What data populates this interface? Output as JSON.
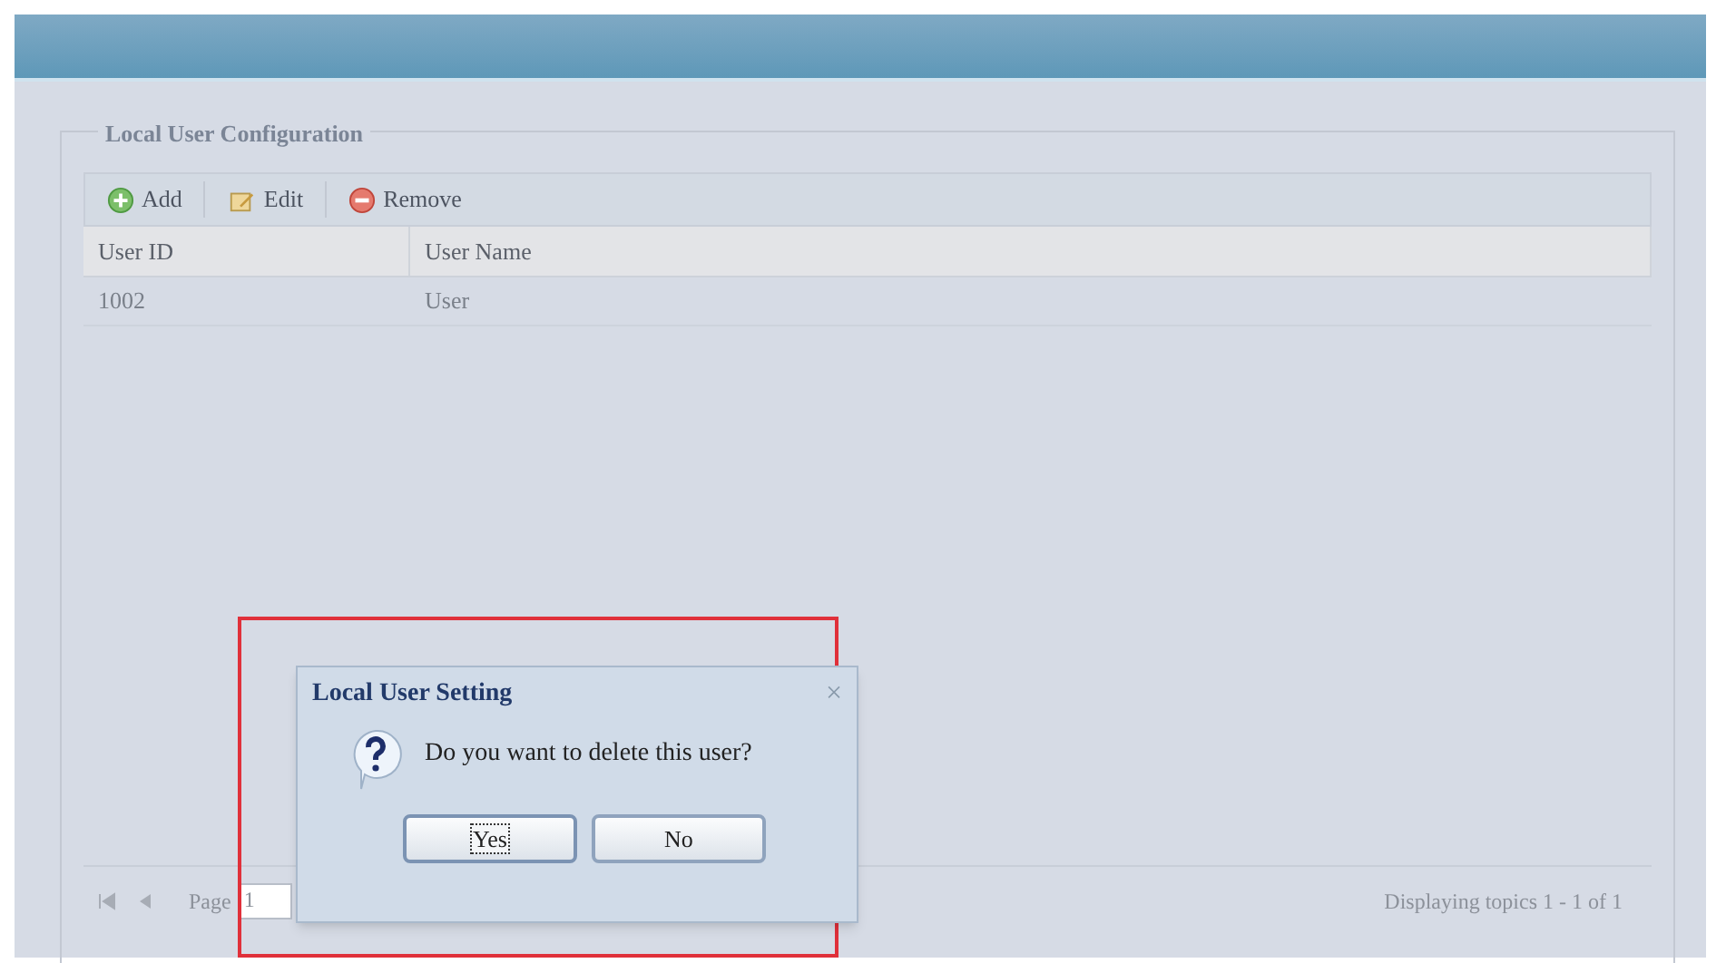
{
  "panel": {
    "legend": "Local User Configuration",
    "toolbar": [
      {
        "kind": "add",
        "label": "Add"
      },
      {
        "kind": "edit",
        "label": "Edit"
      },
      {
        "kind": "remove",
        "label": "Remove"
      }
    ],
    "table": {
      "columns": [
        "User ID",
        "User Name"
      ],
      "rows": [
        [
          "1002",
          "User"
        ]
      ]
    },
    "pager": {
      "page_label": "Page",
      "page_value": "1",
      "summary": "Displaying topics 1 - 1 of 1"
    }
  },
  "dialog": {
    "title": "Local User Setting",
    "close": "×",
    "message": "Do you want to delete this user?",
    "buttons": [
      {
        "label": "Yes",
        "focused": true
      },
      {
        "label": "No",
        "focused": false
      }
    ]
  }
}
